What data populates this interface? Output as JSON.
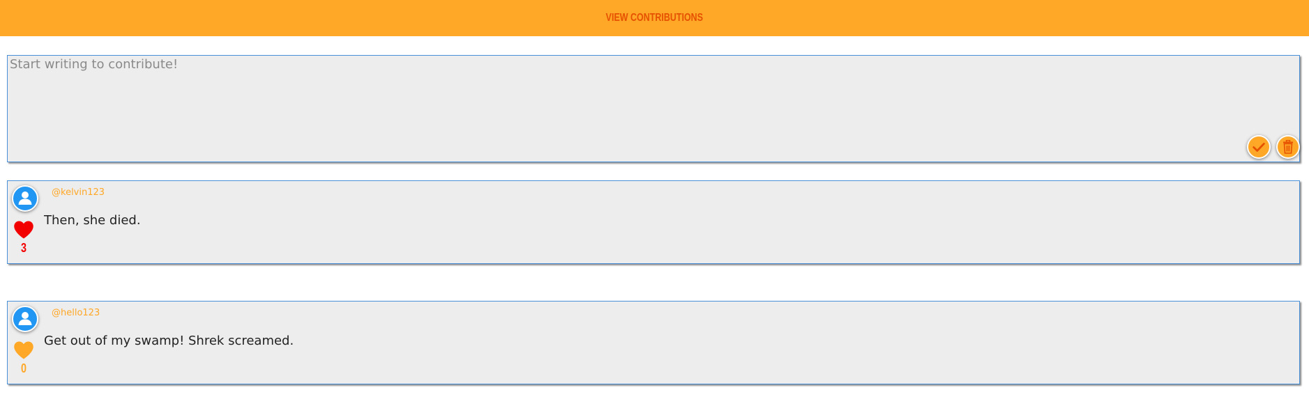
{
  "header": {
    "nav_label": "VIEW CONTRIBUTIONS"
  },
  "composer": {
    "placeholder": "Start writing to contribute!",
    "value": ""
  },
  "colors": {
    "accent": "#ffa726",
    "nav_text": "#e65100",
    "liked": "#f20000",
    "unliked": "#ffa726",
    "border": "#4a90d9",
    "avatar": "#2196f3"
  },
  "contributions": [
    {
      "username": "@kelvin123",
      "text": "Then, she died.",
      "likes": "3",
      "liked": true
    },
    {
      "username": "@hello123",
      "text": "Get out of my swamp! Shrek screamed.",
      "likes": "0",
      "liked": false
    }
  ]
}
